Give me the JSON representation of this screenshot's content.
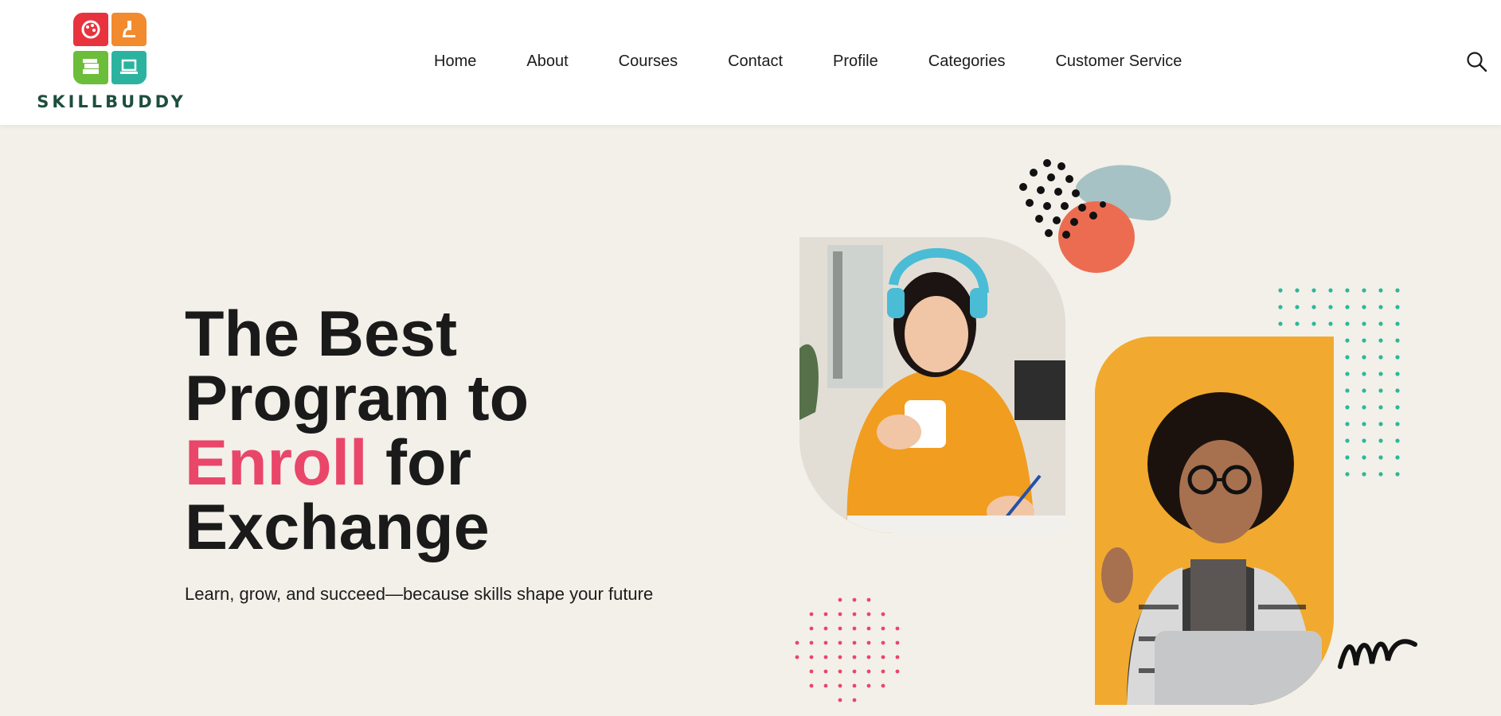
{
  "header": {
    "brand": "SKILLBUDDY",
    "nav": [
      {
        "label": "Home"
      },
      {
        "label": "About"
      },
      {
        "label": "Courses"
      },
      {
        "label": "Contact"
      },
      {
        "label": "Profile"
      },
      {
        "label": "Categories"
      },
      {
        "label": "Customer Service"
      }
    ],
    "search_icon": "search-icon"
  },
  "hero": {
    "title_line1": "The Best",
    "title_line2": "Program to",
    "title_accent": "Enroll",
    "title_line3_rest": " for",
    "title_line4": "Exchange",
    "subtitle": "Learn, grow, and succeed—because skills shape your future"
  },
  "colors": {
    "accent": "#e9466a",
    "brand_text": "#1f4e3d",
    "background": "#f3f0e9",
    "photo2_bg": "#f1aa2f",
    "dots_teal": "#2bb89a",
    "dots_pink": "#e9466a",
    "blob_salmon": "#ec6c52",
    "blob_gray": "#a7c2c4"
  },
  "logo_icons": [
    "palette-icon",
    "microscope-icon",
    "books-icon",
    "laptop-icon"
  ]
}
